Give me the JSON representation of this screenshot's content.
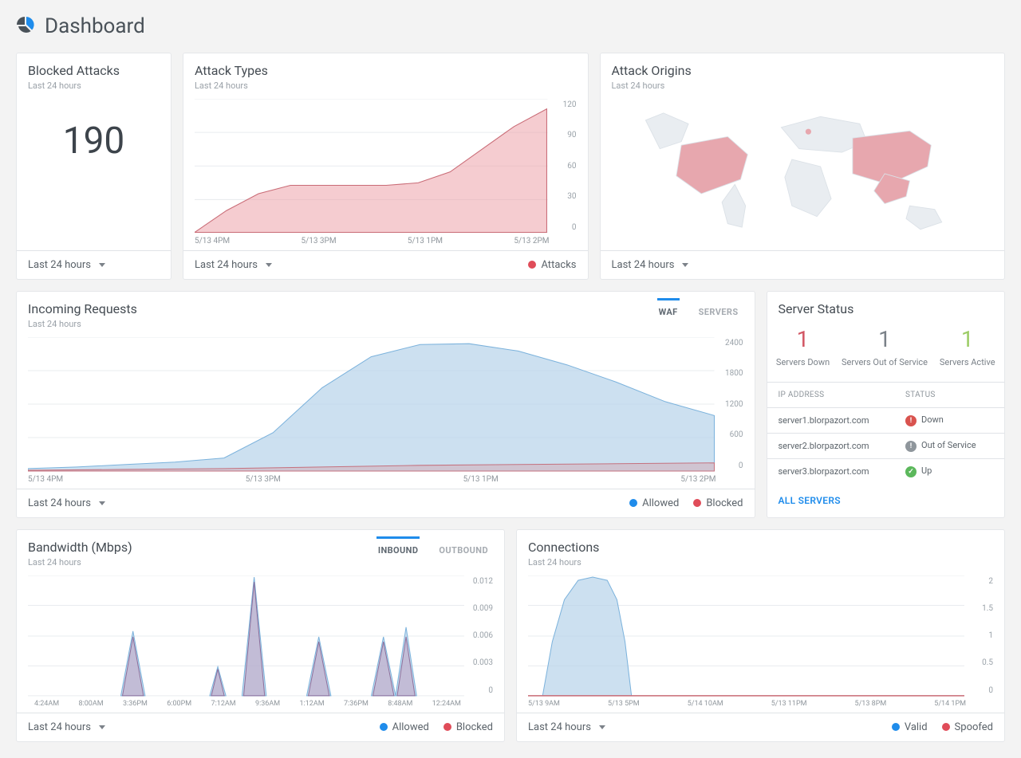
{
  "page": {
    "title": "Dashboard"
  },
  "common": {
    "range_label": "Last 24 hours",
    "sub_last24": "Last 24 hours"
  },
  "blocked": {
    "title": "Blocked Attacks",
    "value": "190"
  },
  "attack_types": {
    "title": "Attack Types",
    "legend": "Attacks"
  },
  "attack_origins": {
    "title": "Attack Origins"
  },
  "incoming": {
    "title": "Incoming Requests",
    "tabs": {
      "waf": "WAF",
      "servers": "SERVERS"
    },
    "legend": {
      "allowed": "Allowed",
      "blocked": "Blocked"
    }
  },
  "server_status": {
    "title": "Server Status",
    "counts": {
      "down_n": "1",
      "down_l": "Servers Down",
      "out_n": "1",
      "out_l": "Servers Out of Service",
      "up_n": "1",
      "up_l": "Servers Active"
    },
    "headers": {
      "ip": "IP ADDRESS",
      "status": "STATUS"
    },
    "rows": [
      {
        "ip": "server1.blorpazort.com",
        "status": "Down",
        "kind": "down"
      },
      {
        "ip": "server2.blorpazort.com",
        "status": "Out of Service",
        "kind": "out"
      },
      {
        "ip": "server3.blorpazort.com",
        "status": "Up",
        "kind": "up"
      }
    ],
    "all_servers": "ALL SERVERS"
  },
  "bandwidth": {
    "title": "Bandwidth (Mbps)",
    "tabs": {
      "inbound": "INBOUND",
      "outbound": "OUTBOUND"
    },
    "legend": {
      "allowed": "Allowed",
      "blocked": "Blocked"
    }
  },
  "connections": {
    "title": "Connections",
    "legend": {
      "valid": "Valid",
      "spoofed": "Spoofed"
    }
  },
  "chart_data": [
    {
      "id": "attack_types",
      "type": "area",
      "title": "Attack Types",
      "x": [
        "5/13 4PM",
        "5/13 3PM",
        "5/13 1PM",
        "5/13 2PM"
      ],
      "y_ticks": [
        0,
        30,
        60,
        90,
        120
      ],
      "series": [
        {
          "name": "Attacks",
          "color": "#e04c59",
          "values": [
            0,
            20,
            35,
            42,
            42,
            42,
            42,
            44,
            55,
            75,
            95,
            110
          ]
        }
      ],
      "ylim": [
        0,
        120
      ]
    },
    {
      "id": "incoming_requests",
      "type": "area",
      "title": "Incoming Requests",
      "x": [
        "5/13 4PM",
        "5/13 3PM",
        "5/13 1PM",
        "5/13 2PM"
      ],
      "y_ticks": [
        0,
        600,
        1200,
        1800,
        2400
      ],
      "series": [
        {
          "name": "Allowed",
          "color": "#1f8ceb",
          "values": [
            50,
            80,
            120,
            160,
            240,
            700,
            1500,
            2050,
            2270,
            2280,
            2150,
            1900,
            1600,
            1250,
            1000
          ]
        },
        {
          "name": "Blocked",
          "color": "#e04c59",
          "values": [
            20,
            25,
            30,
            35,
            40,
            60,
            80,
            95,
            105,
            115,
            125,
            135,
            145,
            150,
            150
          ]
        }
      ],
      "ylim": [
        0,
        2400
      ]
    },
    {
      "id": "bandwidth",
      "type": "area",
      "title": "Bandwidth (Mbps)",
      "x": [
        "4:24AM",
        "8:00AM",
        "3:36PM",
        "6:00PM",
        "7:12AM",
        "9:36AM",
        "1:12AM",
        "7:36PM",
        "8:48AM",
        "12:24AM"
      ],
      "y_ticks": [
        0,
        0.003,
        0.006,
        0.009,
        0.012
      ],
      "series": [
        {
          "name": "Allowed",
          "color": "#1f8ceb",
          "values": [
            0,
            0,
            0.0065,
            0,
            0,
            0.003,
            0.012,
            0,
            0,
            0.006,
            0,
            0,
            0.006,
            0,
            0.007,
            0,
            0
          ]
        },
        {
          "name": "Blocked",
          "color": "#e04c59",
          "values": [
            0,
            0,
            0.006,
            0,
            0,
            0.0028,
            0.0115,
            0,
            0,
            0.0055,
            0,
            0,
            0.0055,
            0,
            0.006,
            0,
            0
          ]
        }
      ],
      "ylim": [
        0,
        0.012
      ]
    },
    {
      "id": "connections",
      "type": "area",
      "title": "Connections",
      "x": [
        "5/13 9AM",
        "5/13 5PM",
        "5/14 10AM",
        "5/13 11PM",
        "5/13 8PM",
        "5/14 1PM"
      ],
      "y_ticks": [
        0,
        0.5,
        1,
        1.5,
        2
      ],
      "series": [
        {
          "name": "Valid",
          "color": "#1f8ceb",
          "values": [
            0,
            0.9,
            1.6,
            1.95,
            2.0,
            1.95,
            1.6,
            0.9,
            0,
            0,
            0,
            0,
            0,
            0,
            0,
            0,
            0,
            0,
            0,
            0,
            0,
            0,
            0,
            0
          ]
        },
        {
          "name": "Spoofed",
          "color": "#e04c59",
          "values": [
            0,
            0,
            0,
            0,
            0,
            0,
            0,
            0,
            0,
            0,
            0,
            0,
            0,
            0,
            0,
            0,
            0,
            0,
            0,
            0,
            0,
            0,
            0,
            0
          ]
        }
      ],
      "ylim": [
        0,
        2
      ]
    },
    {
      "id": "attack_origins",
      "type": "map",
      "title": "Attack Origins",
      "highlighted_regions": [
        "United States",
        "China",
        "Southeast Asia"
      ]
    }
  ]
}
